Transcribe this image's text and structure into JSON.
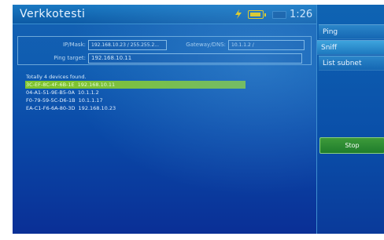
{
  "window": {
    "title": "Verkkotesti",
    "clock": "1:26",
    "status_icons": [
      "signal-icon",
      "battery-icon",
      "battery-empty-icon"
    ],
    "colors": {
      "screen_bg": "#0a4aa8",
      "selected_row": "#7fc32e",
      "stop_button": "#2b8a33",
      "battery": "#ffd400"
    }
  },
  "info": {
    "ip_mask_label": "IP/Mask:",
    "ip_mask_value": "192.168.10.23 / 255.255.2...",
    "gateway_label": "Gateway/DNS:",
    "gateway_value": "10.1.1.2 /",
    "ping_target_label": "Ping target:",
    "ping_target_value": "192.168.10.11"
  },
  "results": {
    "status": "Totally 4 devices found.",
    "devices": [
      {
        "mac": "3C-EF-8C-4F-6B-1E",
        "ip": "192.168.10.11",
        "selected": true
      },
      {
        "mac": "04-A1-51-9E-B5-0A",
        "ip": "10.1.1.2",
        "selected": false
      },
      {
        "mac": "F0-79-59-5C-D6-1B",
        "ip": "10.1.1.17",
        "selected": false
      },
      {
        "mac": "EA-C1-F6-6A-80-3D",
        "ip": "192.168.10.23",
        "selected": false
      }
    ]
  },
  "sidebar": {
    "items": [
      {
        "label": "Ping",
        "active": false
      },
      {
        "label": "Sniff",
        "active": true
      },
      {
        "label": "List subnet",
        "active": false
      }
    ],
    "stop_label": "Stop"
  }
}
